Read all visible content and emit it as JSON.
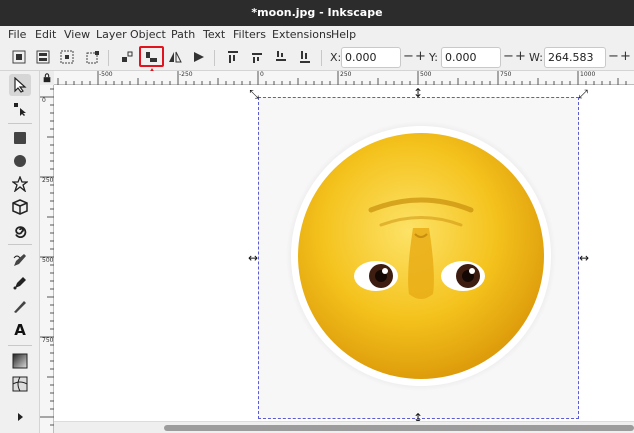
{
  "window": {
    "title": "*moon.jpg - Inkscape"
  },
  "menu": [
    "File",
    "Edit",
    "View",
    "Layer",
    "Object",
    "Path",
    "Text",
    "Filters",
    "Extensions",
    "Help"
  ],
  "coords": {
    "x_label": "X:",
    "x_value": "0.000",
    "y_label": "Y:",
    "y_value": "0.000",
    "w_label": "W:",
    "w_value": "264.583",
    "minus": "−",
    "plus": "+"
  },
  "ruler": {
    "horizontal": [
      "-500",
      "-250",
      "0",
      "250",
      "500",
      "750",
      "1000"
    ],
    "vertical": [
      "0",
      "250",
      "500",
      "750"
    ]
  },
  "tools": {
    "text_tool_glyph": "A"
  },
  "colors": {
    "highlight": "#e0141e",
    "selection": "#5b5bd6",
    "moon_face": "#f4c21c"
  }
}
